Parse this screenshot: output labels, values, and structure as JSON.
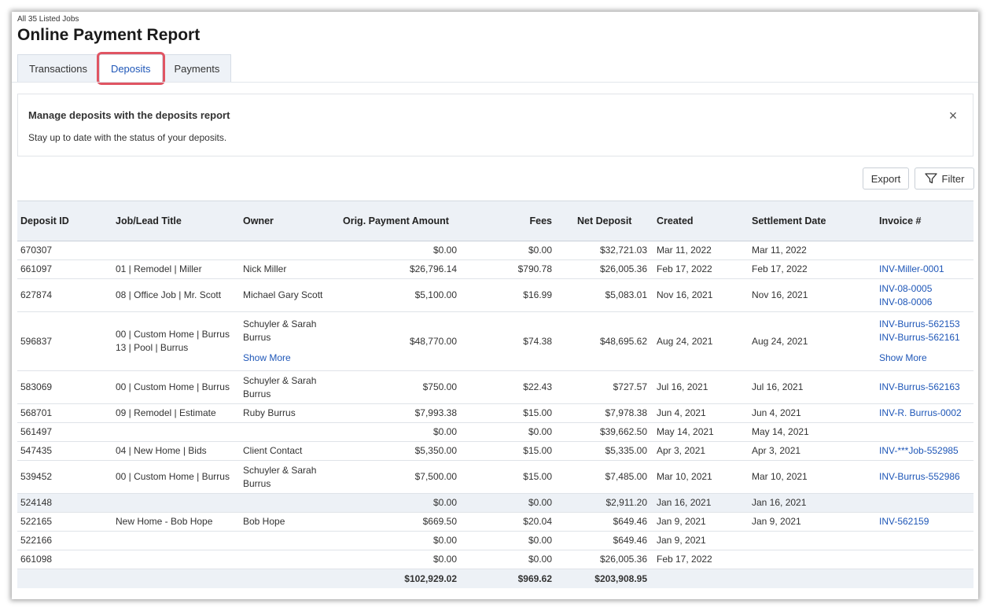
{
  "header": {
    "subtitle": "All 35 Listed Jobs",
    "title": "Online Payment Report"
  },
  "tabs": [
    {
      "label": "Transactions"
    },
    {
      "label": "Deposits"
    },
    {
      "label": "Payments"
    }
  ],
  "banner": {
    "title": "Manage deposits with the deposits report",
    "text": "Stay up to date with the status of your deposits.",
    "close_icon": "×"
  },
  "toolbar": {
    "export_label": "Export",
    "filter_label": "Filter"
  },
  "columns": [
    "Deposit ID",
    "Job/Lead Title",
    "Owner",
    "Orig. Payment Amount",
    "Fees",
    "Net Deposit",
    "Created",
    "Settlement Date",
    "Invoice #"
  ],
  "show_more": "Show More",
  "rows": [
    {
      "id": "670307",
      "job": [],
      "owner": [],
      "orig": "$0.00",
      "fees": "$0.00",
      "net": "$32,721.03",
      "created": "Mar 11, 2022",
      "settle": "Mar 11, 2022",
      "invoices": []
    },
    {
      "id": "661097",
      "job": [
        "01 | Remodel | Miller"
      ],
      "owner": [
        "Nick Miller"
      ],
      "orig": "$26,796.14",
      "fees": "$790.78",
      "net": "$26,005.36",
      "created": "Feb 17, 2022",
      "settle": "Feb 17, 2022",
      "invoices": [
        "INV-Miller-0001"
      ]
    },
    {
      "id": "627874",
      "job": [
        "08 | Office Job | Mr. Scott"
      ],
      "owner": [
        "Michael Gary Scott"
      ],
      "orig": "$5,100.00",
      "fees": "$16.99",
      "net": "$5,083.01",
      "created": "Nov 16, 2021",
      "settle": "Nov 16, 2021",
      "invoices": [
        "INV-08-0005",
        "INV-08-0006"
      ]
    },
    {
      "id": "596837",
      "job": [
        "00 | Custom Home | Burrus",
        "13 | Pool | Burrus"
      ],
      "owner": [
        "Schuyler & Sarah",
        "Burrus"
      ],
      "orig": "$48,770.00",
      "fees": "$74.38",
      "net": "$48,695.62",
      "created": "Aug 24, 2021",
      "settle": "Aug 24, 2021",
      "invoices": [
        "INV-Burrus-562153",
        "INV-Burrus-562161"
      ]
    },
    {
      "id": "583069",
      "job": [
        "00 | Custom Home | Burrus"
      ],
      "owner": [
        "Schuyler & Sarah",
        "Burrus"
      ],
      "orig": "$750.00",
      "fees": "$22.43",
      "net": "$727.57",
      "created": "Jul 16, 2021",
      "settle": "Jul 16, 2021",
      "invoices": [
        "INV-Burrus-562163"
      ]
    },
    {
      "id": "568701",
      "job": [
        "09 | Remodel | Estimate"
      ],
      "owner": [
        "Ruby  Burrus"
      ],
      "orig": "$7,993.38",
      "fees": "$15.00",
      "net": "$7,978.38",
      "created": "Jun 4, 2021",
      "settle": "Jun 4, 2021",
      "invoices": [
        "INV-R. Burrus-0002"
      ]
    },
    {
      "id": "561497",
      "job": [],
      "owner": [],
      "orig": "$0.00",
      "fees": "$0.00",
      "net": "$39,662.50",
      "created": "May 14, 2021",
      "settle": "May 14, 2021",
      "invoices": []
    },
    {
      "id": "547435",
      "job": [
        "04 | New Home | Bids"
      ],
      "owner": [
        "Client Contact"
      ],
      "orig": "$5,350.00",
      "fees": "$15.00",
      "net": "$5,335.00",
      "created": "Apr 3, 2021",
      "settle": "Apr 3, 2021",
      "invoices": [
        "INV-***Job-552985"
      ]
    },
    {
      "id": "539452",
      "job": [
        "00 | Custom Home | Burrus"
      ],
      "owner": [
        "Schuyler & Sarah",
        "Burrus"
      ],
      "orig": "$7,500.00",
      "fees": "$15.00",
      "net": "$7,485.00",
      "created": "Mar 10, 2021",
      "settle": "Mar 10, 2021",
      "invoices": [
        "INV-Burrus-552986"
      ]
    },
    {
      "id": "524148",
      "job": [],
      "owner": [],
      "orig": "$0.00",
      "fees": "$0.00",
      "net": "$2,911.20",
      "created": "Jan 16, 2021",
      "settle": "Jan 16, 2021",
      "invoices": []
    },
    {
      "id": "522165",
      "job": [
        "New Home - Bob Hope"
      ],
      "owner": [
        "Bob Hope"
      ],
      "orig": "$669.50",
      "fees": "$20.04",
      "net": "$649.46",
      "created": "Jan 9, 2021",
      "settle": "Jan 9, 2021",
      "invoices": [
        "INV-562159"
      ]
    },
    {
      "id": "522166",
      "job": [],
      "owner": [],
      "orig": "$0.00",
      "fees": "$0.00",
      "net": "$649.46",
      "created": "Jan 9, 2021",
      "settle": "",
      "invoices": []
    },
    {
      "id": "661098",
      "job": [],
      "owner": [],
      "orig": "$0.00",
      "fees": "$0.00",
      "net": "$26,005.36",
      "created": "Feb 17, 2022",
      "settle": "",
      "invoices": []
    }
  ],
  "totals": {
    "orig": "$102,929.02",
    "fees": "$969.62",
    "net": "$203,908.95"
  },
  "colors": {
    "link": "#1f57b8",
    "header_bg": "#edf1f6",
    "tab_highlight": "#e05563"
  }
}
